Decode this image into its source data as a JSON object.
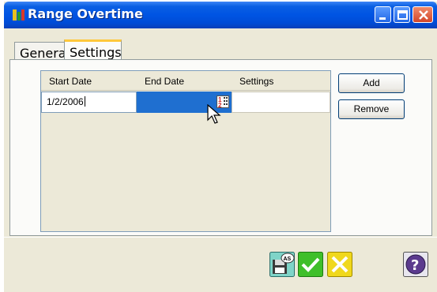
{
  "window": {
    "title": "Range Overtime"
  },
  "tabs": [
    {
      "label": "General",
      "active": false
    },
    {
      "label": "Settings",
      "active": true
    }
  ],
  "grid": {
    "columns": [
      "Start Date",
      "End Date",
      "Settings"
    ],
    "rows": [
      {
        "start_date": "1/2/2006",
        "end_date": "",
        "settings": ""
      }
    ]
  },
  "buttons": {
    "add_label": "Add",
    "remove_label": "Remove"
  },
  "icons": {
    "app": "range-overtime-app-icon",
    "calendar": "calendar-icon",
    "save_as": "save-as-icon",
    "ok": "checkmark-icon",
    "cancel": "cancel-x-icon",
    "help": "help-icon",
    "cursor": "mouse-pointer-icon"
  },
  "colors": {
    "titlebar": "#0054e3",
    "selection": "#1f6fd0",
    "ok_green": "#3fbf2a",
    "cancel_yellow": "#f0d81c",
    "help_purple": "#5b3a8e",
    "tab_highlight": "#ffc83c"
  }
}
